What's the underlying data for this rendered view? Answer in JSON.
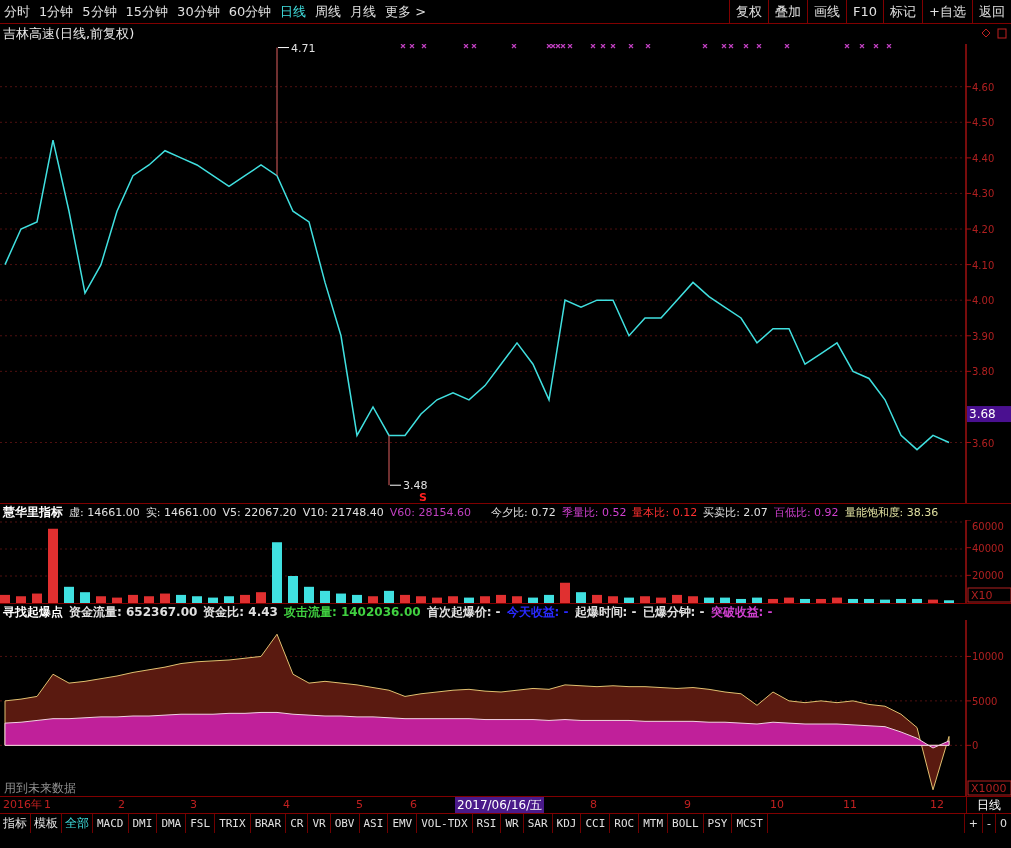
{
  "toolbar": {
    "periods": [
      {
        "label": "分时",
        "selected": false
      },
      {
        "label": "1分钟",
        "selected": false
      },
      {
        "label": "5分钟",
        "selected": false
      },
      {
        "label": "15分钟",
        "selected": false
      },
      {
        "label": "30分钟",
        "selected": false
      },
      {
        "label": "60分钟",
        "selected": false
      },
      {
        "label": "日线",
        "selected": true
      },
      {
        "label": "周线",
        "selected": false
      },
      {
        "label": "月线",
        "selected": false
      },
      {
        "label": "更多 >",
        "selected": false
      }
    ],
    "actions": [
      "复权",
      "叠加",
      "画线",
      "F10",
      "标记",
      "+自选",
      "返回"
    ]
  },
  "price_chart": {
    "title": "吉林高速(日线,前复权)",
    "current_price": "3.68",
    "sell_mark": "S",
    "chart_data": {
      "type": "line",
      "ylim": [
        3.43,
        4.72
      ],
      "yticks": [
        {
          "value": 4.6,
          "label": "4.60"
        },
        {
          "value": 4.5,
          "label": "4.50"
        },
        {
          "value": 4.4,
          "label": "4.40"
        },
        {
          "value": 4.3,
          "label": "4.30"
        },
        {
          "value": 4.2,
          "label": "4.20"
        },
        {
          "value": 4.1,
          "label": "4.10"
        },
        {
          "value": 4.0,
          "label": "4.00"
        },
        {
          "value": 3.9,
          "label": "3.90"
        },
        {
          "value": 3.8,
          "label": "3.80"
        },
        {
          "value": 3.6,
          "label": "3.60"
        }
      ],
      "series": [
        {
          "color": "#40e0e0",
          "values": [
            4.1,
            4.2,
            4.22,
            4.45,
            4.25,
            4.02,
            4.1,
            4.25,
            4.35,
            4.38,
            4.42,
            4.4,
            4.38,
            4.35,
            4.32,
            4.35,
            4.38,
            4.35,
            4.25,
            4.22,
            4.05,
            3.9,
            3.62,
            3.7,
            3.62,
            3.62,
            3.68,
            3.72,
            3.74,
            3.72,
            3.76,
            3.82,
            3.88,
            3.82,
            3.72,
            4.0,
            3.98,
            4.0,
            4.0,
            3.9,
            3.95,
            3.95,
            4.0,
            4.05,
            4.01,
            3.98,
            3.95,
            3.88,
            3.92,
            3.92,
            3.82,
            3.85,
            3.88,
            3.8,
            3.78,
            3.72,
            3.62,
            3.58,
            3.62,
            3.6
          ]
        }
      ],
      "grid": true,
      "annotations": [
        "4.71",
        "3.48"
      ]
    }
  },
  "volume_pane": {
    "legend": [
      {
        "text": "慧华里指标",
        "color": "#ffffff"
      },
      {
        "text": "虚: 14661.00",
        "color": "#e0e0e0"
      },
      {
        "text": "实: 14661.00",
        "color": "#e0e0e0"
      },
      {
        "text": "V5: 22067.20",
        "color": "#e0e0e0"
      },
      {
        "text": "V10: 21748.40",
        "color": "#e0e0e0"
      },
      {
        "text": "V60: 28154.60",
        "color": "#c040c0"
      },
      {
        "text": "今夕比: 0.72",
        "color": "#e0e0e0"
      },
      {
        "text": "季量比: 0.52",
        "color": "#d040d0"
      },
      {
        "text": "量本比: 0.12",
        "color": "#ff3030"
      },
      {
        "text": "买卖比: 2.07",
        "color": "#e0e0e0"
      },
      {
        "text": "百低比: 0.92",
        "color": "#d040d0"
      },
      {
        "text": "量能饱和度: 38.36",
        "color": "#e0e0a0"
      }
    ],
    "multiplier": "X10",
    "chart_data": {
      "type": "bar",
      "ylim": [
        0,
        60000
      ],
      "yticks": [
        60000,
        40000,
        20000
      ],
      "grid": true,
      "values": [
        6000,
        5000,
        7000,
        55000,
        12000,
        8000,
        5000,
        4000,
        6000,
        5000,
        7000,
        6000,
        5000,
        4000,
        5000,
        6000,
        8000,
        45000,
        20000,
        12000,
        9000,
        7000,
        6000,
        5000,
        9000,
        6000,
        5000,
        4000,
        5000,
        4000,
        5000,
        6000,
        5000,
        4000,
        6000,
        15000,
        8000,
        6000,
        5000,
        4000,
        5000,
        4000,
        6000,
        5000,
        4000,
        4000,
        3000,
        4000,
        3000,
        4000,
        3000,
        3000,
        4000,
        3000,
        3000,
        2500,
        3000,
        3000,
        2500,
        2000
      ]
    }
  },
  "fund_pane": {
    "legend": [
      {
        "text": "寻找起爆点",
        "color": "#ffffff"
      },
      {
        "text": "资金流量: 652367.00",
        "color": "#e0e0e0"
      },
      {
        "text": "资金比: 4.43",
        "color": "#e0e0e0"
      },
      {
        "text": "攻击流量: 1402036.00",
        "color": "#40d040"
      },
      {
        "text": "首次起爆价: -",
        "color": "#e0e0e0"
      },
      {
        "text": "今天收益: -",
        "color": "#2a2aff"
      },
      {
        "text": "起爆时间: -",
        "color": "#e0e0e0"
      },
      {
        "text": "已爆分钟: -",
        "color": "#e0e0e0"
      },
      {
        "text": "突破收益: -",
        "color": "#d040d0"
      }
    ],
    "note": "用到未来数据",
    "multiplier": "X1000",
    "chart_data": {
      "type": "area",
      "ylim": [
        -5700,
        14100
      ],
      "yticks": [
        10000,
        5000,
        0
      ],
      "grid": true,
      "series": [
        {
          "color": "#e0c070",
          "values": [
            5000,
            5200,
            5500,
            8000,
            7000,
            7200,
            7500,
            7800,
            8200,
            8500,
            8800,
            9200,
            9400,
            9500,
            9600,
            9800,
            10000,
            12500,
            8000,
            7000,
            7200,
            7000,
            6800,
            6500,
            6200,
            5500,
            5800,
            6000,
            6200,
            6300,
            6100,
            6000,
            6200,
            6400,
            6300,
            6800,
            6700,
            6600,
            6700,
            6600,
            6600,
            6500,
            6400,
            6500,
            6300,
            6000,
            5800,
            4500,
            6000,
            5000,
            4800,
            5000,
            4800,
            5000,
            4600,
            4400,
            3500,
            2000,
            -5000,
            1000
          ]
        },
        {
          "color": "#c0209a",
          "values": [
            2500,
            2600,
            2800,
            3000,
            3000,
            3100,
            3200,
            3200,
            3300,
            3300,
            3400,
            3500,
            3500,
            3500,
            3600,
            3600,
            3700,
            3700,
            3500,
            3400,
            3300,
            3300,
            3200,
            3200,
            3100,
            3000,
            3000,
            3000,
            3000,
            3000,
            2900,
            2900,
            2900,
            2900,
            2800,
            2900,
            2800,
            2800,
            2800,
            2800,
            2700,
            2700,
            2700,
            2700,
            2600,
            2600,
            2500,
            2400,
            2600,
            2500,
            2400,
            2400,
            2400,
            2300,
            2200,
            2100,
            1500,
            800,
            -300,
            500
          ]
        }
      ]
    }
  },
  "date_axis": {
    "labels": [
      "2016年",
      "1",
      "2",
      "3",
      "4",
      "5",
      "6",
      "8",
      "9",
      "10",
      "11",
      "12"
    ],
    "cursor_date": "2017/06/16/五",
    "period": "日线"
  },
  "indicator_tabs": [
    {
      "label": "指标",
      "selected": false
    },
    {
      "label": "模板",
      "selected": false
    },
    {
      "label": "全部",
      "selected": true
    },
    {
      "label": "MACD",
      "selected": false
    },
    {
      "label": "DMI",
      "selected": false
    },
    {
      "label": "DMA",
      "selected": false
    },
    {
      "label": "FSL",
      "selected": false
    },
    {
      "label": "TRIX",
      "selected": false
    },
    {
      "label": "BRAR",
      "selected": false
    },
    {
      "label": "CR",
      "selected": false
    },
    {
      "label": "VR",
      "selected": false
    },
    {
      "label": "OBV",
      "selected": false
    },
    {
      "label": "ASI",
      "selected": false
    },
    {
      "label": "EMV",
      "selected": false
    },
    {
      "label": "VOL-TDX",
      "selected": false
    },
    {
      "label": "RSI",
      "selected": false
    },
    {
      "label": "WR",
      "selected": false
    },
    {
      "label": "SAR",
      "selected": false
    },
    {
      "label": "KDJ",
      "selected": false
    },
    {
      "label": "CCI",
      "selected": false
    },
    {
      "label": "ROC",
      "selected": false
    },
    {
      "label": "MTM",
      "selected": false
    },
    {
      "label": "BOLL",
      "selected": false
    },
    {
      "label": "PSY",
      "selected": false
    },
    {
      "label": "MCST",
      "selected": false
    }
  ],
  "zoom_buttons": [
    "+",
    "-",
    "0"
  ]
}
